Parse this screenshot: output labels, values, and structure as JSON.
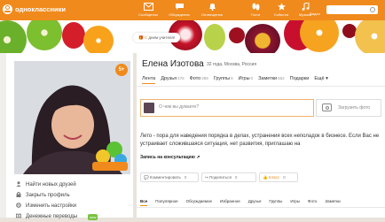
{
  "brand": {
    "name": "одноклассники",
    "accent": "#f08a1c"
  },
  "nav": [
    {
      "label": "Сообщения",
      "icon": "envelope-icon"
    },
    {
      "label": "Обсуждения",
      "icon": "chat-icon"
    },
    {
      "label": "Оповещения",
      "icon": "bell-icon"
    },
    {
      "label": "Гости",
      "icon": "footprints-icon"
    },
    {
      "label": "События",
      "icon": "star-icon"
    },
    {
      "label": "Музыка",
      "icon": "music-icon"
    },
    {
      "label": "Видео",
      "icon": "video-icon"
    }
  ],
  "banner": {
    "gift_prefix": "С ",
    "gift_text": "днем учителя!"
  },
  "profile": {
    "avatar_badge": "5+",
    "name": "Елена Изотова",
    "meta": "32 года, Москва, Россия"
  },
  "tabs": [
    {
      "label": "Лента",
      "count": ""
    },
    {
      "label": "Друзья",
      "count": "475"
    },
    {
      "label": "Фото",
      "count": "289"
    },
    {
      "label": "Группы",
      "count": "8"
    },
    {
      "label": "Игры",
      "count": "0"
    },
    {
      "label": "Заметки",
      "count": "662"
    },
    {
      "label": "Подарки",
      "count": ""
    },
    {
      "label": "Ещё ▾",
      "count": ""
    }
  ],
  "composer": {
    "placeholder": "О чем вы думаете?",
    "upload_label": "Загрузить фото"
  },
  "post": {
    "text": "Лето - пора для наведения порядка в делах, устранения всех неполадок в бизнесе. Если Вас не устраивает сложившаяся ситуация, нет развития, приглашаю на",
    "link": "Запись на консультацию ↗",
    "actions": [
      {
        "label": "Комментировать",
        "count": "0"
      },
      {
        "label": "Поделиться",
        "count": "0"
      },
      {
        "label": "Класс",
        "count": "0"
      }
    ]
  },
  "feed_tabs": [
    "Все",
    "Популярное",
    "Обсуждаемое",
    "Избранное",
    "Друзья",
    "Группы",
    "Игры",
    "Фото",
    "Заметки"
  ],
  "side_links": [
    {
      "label": "Найти новых друзей",
      "icon": "user-icon",
      "badge": ""
    },
    {
      "label": "Закрыть профиль",
      "icon": "lock-icon",
      "badge": ""
    },
    {
      "label": "Изменить настройки",
      "icon": "gear-icon",
      "badge": ""
    },
    {
      "label": "Денежные переводы",
      "icon": "money-icon",
      "badge": "new"
    }
  ]
}
